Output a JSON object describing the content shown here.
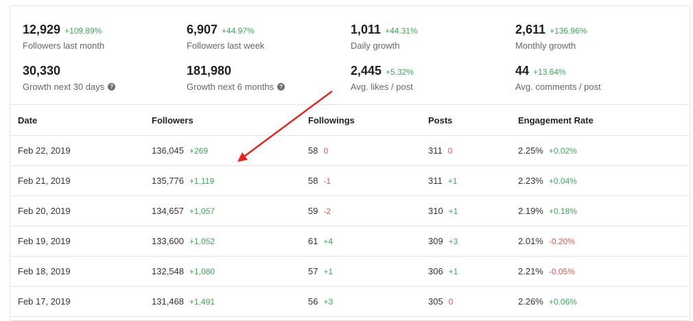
{
  "stats": [
    {
      "value": "12,929",
      "change": "+109.89%",
      "label": "Followers last month",
      "help": false
    },
    {
      "value": "6,907",
      "change": "+44.97%",
      "label": "Followers last week",
      "help": false
    },
    {
      "value": "1,011",
      "change": "+44.31%",
      "label": "Daily growth",
      "help": false
    },
    {
      "value": "2,611",
      "change": "+136.96%",
      "label": "Monthly growth",
      "help": false
    },
    {
      "value": "30,330",
      "change": "",
      "label": "Growth next 30 days",
      "help": true
    },
    {
      "value": "181,980",
      "change": "",
      "label": "Growth next 6 months",
      "help": true
    },
    {
      "value": "2,445",
      "change": "+5.32%",
      "label": "Avg. likes / post",
      "help": false
    },
    {
      "value": "44",
      "change": "+13.64%",
      "label": "Avg. comments / post",
      "help": false
    }
  ],
  "help_glyph": "?",
  "table": {
    "headers": [
      "Date",
      "Followers",
      "Followings",
      "Posts",
      "Engagement Rate"
    ],
    "rows": [
      {
        "date": "Feb 22, 2019",
        "followers": "136,045",
        "followers_delta": "+269",
        "followings": "58",
        "followings_delta": "0",
        "posts": "311",
        "posts_delta": "0",
        "er": "2.25%",
        "er_delta": "+0.02%"
      },
      {
        "date": "Feb 21, 2019",
        "followers": "135,776",
        "followers_delta": "+1,119",
        "followings": "58",
        "followings_delta": "-1",
        "posts": "311",
        "posts_delta": "+1",
        "er": "2.23%",
        "er_delta": "+0.04%"
      },
      {
        "date": "Feb 20, 2019",
        "followers": "134,657",
        "followers_delta": "+1,057",
        "followings": "59",
        "followings_delta": "-2",
        "posts": "310",
        "posts_delta": "+1",
        "er": "2.19%",
        "er_delta": "+0.18%"
      },
      {
        "date": "Feb 19, 2019",
        "followers": "133,600",
        "followers_delta": "+1,052",
        "followings": "61",
        "followings_delta": "+4",
        "posts": "309",
        "posts_delta": "+3",
        "er": "2.01%",
        "er_delta": "-0.20%"
      },
      {
        "date": "Feb 18, 2019",
        "followers": "132,548",
        "followers_delta": "+1,080",
        "followings": "57",
        "followings_delta": "+1",
        "posts": "306",
        "posts_delta": "+1",
        "er": "2.21%",
        "er_delta": "-0.05%"
      },
      {
        "date": "Feb 17, 2019",
        "followers": "131,468",
        "followers_delta": "+1,491",
        "followings": "56",
        "followings_delta": "+3",
        "posts": "305",
        "posts_delta": "0",
        "er": "2.26%",
        "er_delta": "+0.06%"
      }
    ]
  },
  "colors": {
    "positive": "#3aa757",
    "negative": "#d9534f",
    "annotation_arrow": "#e8231c"
  }
}
